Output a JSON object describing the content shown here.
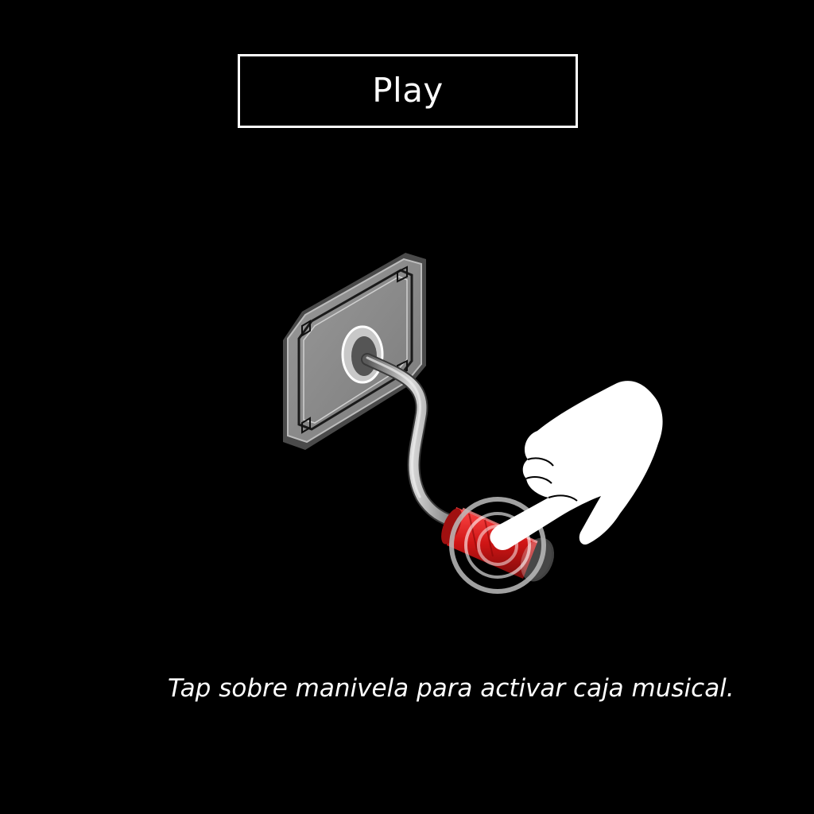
{
  "play_button": {
    "label": "Play"
  },
  "instruction": {
    "text": "Tap sobre manivela para activar caja musical."
  },
  "icons": {
    "crank": "music-box-crank-icon",
    "hand": "pointing-hand-icon",
    "tap_indicator": "tap-ripple-icon"
  },
  "colors": {
    "background": "#000000",
    "text": "#ffffff",
    "plate": "#8a8a8a",
    "handle": "#d01515"
  }
}
